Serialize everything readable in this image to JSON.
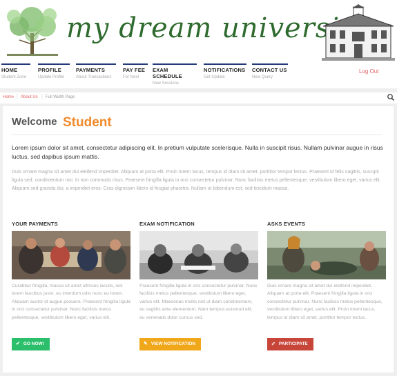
{
  "brand": {
    "title": "my dream university"
  },
  "nav": {
    "items": [
      {
        "label": "HOME",
        "sub": "Student Zone"
      },
      {
        "label": "PROFILE",
        "sub": "Update Profile"
      },
      {
        "label": "PAYMENTS",
        "sub": "About Transactions"
      },
      {
        "label": "PAY FEE",
        "sub": "For Next"
      },
      {
        "label": "EXAM SCHEDULE",
        "sub": "New Sessions"
      },
      {
        "label": "NOTIFICATIONS",
        "sub": "Get Update"
      },
      {
        "label": "CONTACT US",
        "sub": "New Query"
      }
    ],
    "logout": "Log Out"
  },
  "breadcrumb": {
    "home": "Home",
    "about": "About Us",
    "page": "Full Width Page",
    "sep": "|"
  },
  "welcome": {
    "label": "Welcome",
    "name": "Student"
  },
  "intro": {
    "lead": "Lorem ipsum dolor sit amet, consectetur adipiscing elit. In pretium vulputate scelerisque. Nulla in suscipit risus. Nullam pulvinar augue in risus luctus, sed dapibus ipsum mattis.",
    "body": "Duis ornare magna sit amet dui eleifend imperdiet. Aliquam at porta elit. Proin lorem lacus, tempus id diam sit amet, porttitor tempor lectus. Praesent id felis sagittis, suscipit ligula sed, condimentum nisi. In non commodo risus. Praesent fringilla ligula in orci consectetur pulvinar. Nunc facilisis metus pellentesque, vestibulum libero eget, varius elit. Aliquam sed gravida dui, a imperdiet eros. Cras dignissim libero id feugiat pharetra. Nullam ut bibendum est, sed tincidunt massa."
  },
  "columns": [
    {
      "title": "YOUR PAYMENTS",
      "text": "Curabitur fringilla, massa sit amet ultricies iaculis, nisl lorem faucibus justo, eu interdum odio nunc eu lorem. Aliquam auctor id augue posuere. Praesent fringilla ligula in orci consectetur pulvinar. Nunc facilisis metus pellentesque, vestibulum libero eget, varius elit.",
      "button": "GO NOW!"
    },
    {
      "title": "EXAM NOTIFICATION",
      "text": "Praesent fringilla ligula in orci consectetur pulvinar. Nunc facilisis metus pellentesque, vestibulum libero eget, varius elit. Maecenas mollis nisl ut diam condimentum, eu sagittis ante elementum. Nam tempus euismod elit, eu venenatis dolor cursus sed.",
      "button": "VIEW NOTIFICATION"
    },
    {
      "title": "ASKS EVENTS",
      "text": "Duis ornare magna sit amet dui eleifend imperdiet. Aliquam at porta elit. Praesent fringilla ligula in orci consectetur pulvinar. Nunc facilisis metus pellentesque, vestibulum libero eget, varius elit. Proin lorem lacus, tempus id diam sit amet, porttitor tempor lectus.",
      "button": "PARTICIPATE"
    }
  ],
  "colors": {
    "nav_rule": "#233a7a",
    "accent_orange": "#f08a2a",
    "logo_green": "#2f6b2f",
    "btn_green": "#2bbf6b",
    "btn_amber": "#f0a71a",
    "btn_red": "#c8453a",
    "link_red": "#e06060"
  },
  "icons": {
    "search": "search-icon",
    "go": "check-icon",
    "view": "pencil-icon",
    "participate": "rocket-icon"
  }
}
